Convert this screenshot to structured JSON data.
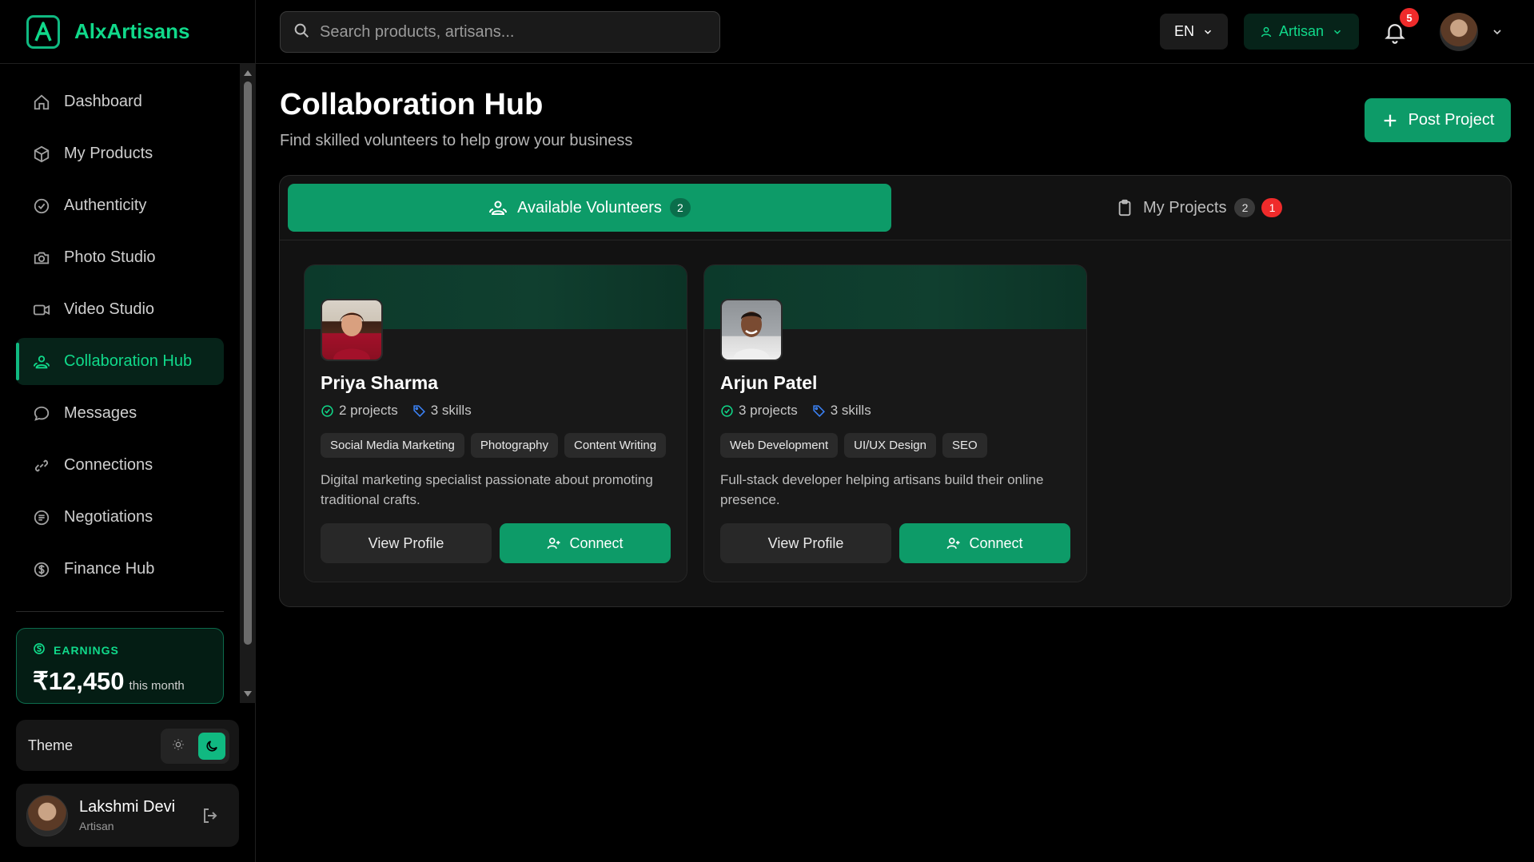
{
  "app": {
    "name": "AlxArtisans"
  },
  "sidebar": {
    "items": [
      {
        "label": "Dashboard",
        "icon": "home-icon"
      },
      {
        "label": "My Products",
        "icon": "package-icon"
      },
      {
        "label": "Authenticity",
        "icon": "check-circle-icon"
      },
      {
        "label": "Photo Studio",
        "icon": "camera-icon"
      },
      {
        "label": "Video Studio",
        "icon": "video-icon"
      },
      {
        "label": "Collaboration Hub",
        "icon": "users-icon",
        "active": true
      },
      {
        "label": "Messages",
        "icon": "message-icon"
      },
      {
        "label": "Connections",
        "icon": "link-icon"
      },
      {
        "label": "Negotiations",
        "icon": "handshake-icon"
      },
      {
        "label": "Finance Hub",
        "icon": "dollar-icon"
      }
    ],
    "earnings": {
      "label": "EARNINGS",
      "amount": "₹12,450",
      "period": "this month"
    },
    "theme": {
      "label": "Theme",
      "mode": "dark"
    },
    "user": {
      "name": "Lakshmi Devi",
      "role": "Artisan"
    }
  },
  "topbar": {
    "search_placeholder": "Search products, artisans...",
    "language": "EN",
    "role": "Artisan",
    "notification_count": "5"
  },
  "page": {
    "title": "Collaboration Hub",
    "subtitle": "Find skilled volunteers to help grow your business",
    "post_button": "Post Project"
  },
  "tabs": {
    "available": {
      "label": "Available Volunteers",
      "count": "2"
    },
    "projects": {
      "label": "My Projects",
      "count": "2",
      "alert": "1"
    }
  },
  "volunteers": [
    {
      "name": "Priya Sharma",
      "projects": "2 projects",
      "skills": "3 skills",
      "tags": [
        "Social Media Marketing",
        "Photography",
        "Content Writing"
      ],
      "description": "Digital marketing specialist passionate about promoting traditional crafts.",
      "view_label": "View Profile",
      "connect_label": "Connect"
    },
    {
      "name": "Arjun Patel",
      "projects": "3 projects",
      "skills": "3 skills",
      "tags": [
        "Web Development",
        "UI/UX Design",
        "SEO"
      ],
      "description": "Full-stack developer helping artisans build their online presence.",
      "view_label": "View Profile",
      "connect_label": "Connect"
    }
  ],
  "colors": {
    "accent": "#10b981",
    "accent_dark": "#0d9b68",
    "danger": "#ef2b2b",
    "background": "#000000"
  }
}
